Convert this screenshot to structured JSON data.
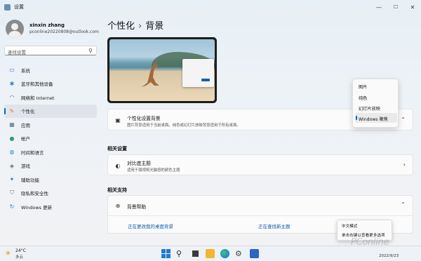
{
  "window": {
    "title": "设置",
    "min": "—",
    "max": "☐",
    "close": "✕"
  },
  "user": {
    "name": "xinxin zhang",
    "email": "pconline20220808@outlook.com"
  },
  "search": {
    "placeholder": "查找设置",
    "icon": "search-icon"
  },
  "nav": [
    {
      "label": "系统",
      "icon": "monitor-icon",
      "color": "#3a76c8"
    },
    {
      "label": "蓝牙和其他设备",
      "icon": "bluetooth-icon",
      "color": "#2a7fd4"
    },
    {
      "label": "网络和 Internet",
      "icon": "wifi-icon",
      "color": "#3f6fb5"
    },
    {
      "label": "个性化",
      "icon": "brush-icon",
      "color": "#d07a2a",
      "active": true
    },
    {
      "label": "应用",
      "icon": "apps-icon",
      "color": "#4f6b8c"
    },
    {
      "label": "帐户",
      "icon": "person-icon",
      "color": "#2e9e6a"
    },
    {
      "label": "时间和语言",
      "icon": "globe-clock-icon",
      "color": "#2b8ad0"
    },
    {
      "label": "游戏",
      "icon": "gamepad-icon",
      "color": "#6a6a6a"
    },
    {
      "label": "辅助功能",
      "icon": "accessibility-icon",
      "color": "#2b6cc4"
    },
    {
      "label": "隐私和安全性",
      "icon": "shield-icon",
      "color": "#5f6f82"
    },
    {
      "label": "Windows 更新",
      "icon": "update-icon",
      "color": "#1f7bd1"
    }
  ],
  "breadcrumb": {
    "parent": "个性化",
    "separator": "›",
    "current": "背景"
  },
  "background_card": {
    "title": "个性化设置背景",
    "subtitle": "图片背景适用于当前桌面。纯色或幻灯片放映背景适用于所有桌面。",
    "selected": "Windows 聚焦"
  },
  "dropdown": {
    "options": [
      "图片",
      "纯色",
      "幻灯片放映",
      "Windows 聚焦"
    ]
  },
  "related_settings": {
    "heading": "相关设置",
    "contrast_title": "对比度主题",
    "contrast_sub": "适用于弱视和光敏感的颜色主题"
  },
  "related_support": {
    "heading": "相关支持",
    "help_title": "背景帮助",
    "link1": "正在更改我的桌面背景",
    "link2": "正在查找新主题"
  },
  "context_menu": {
    "items": [
      "中文模式",
      "单击右键以查看更多选项"
    ]
  },
  "taskbar": {
    "weather_temp": "24°C",
    "weather_desc": "多云",
    "date": "2022/9/23"
  },
  "watermark": "PConline"
}
